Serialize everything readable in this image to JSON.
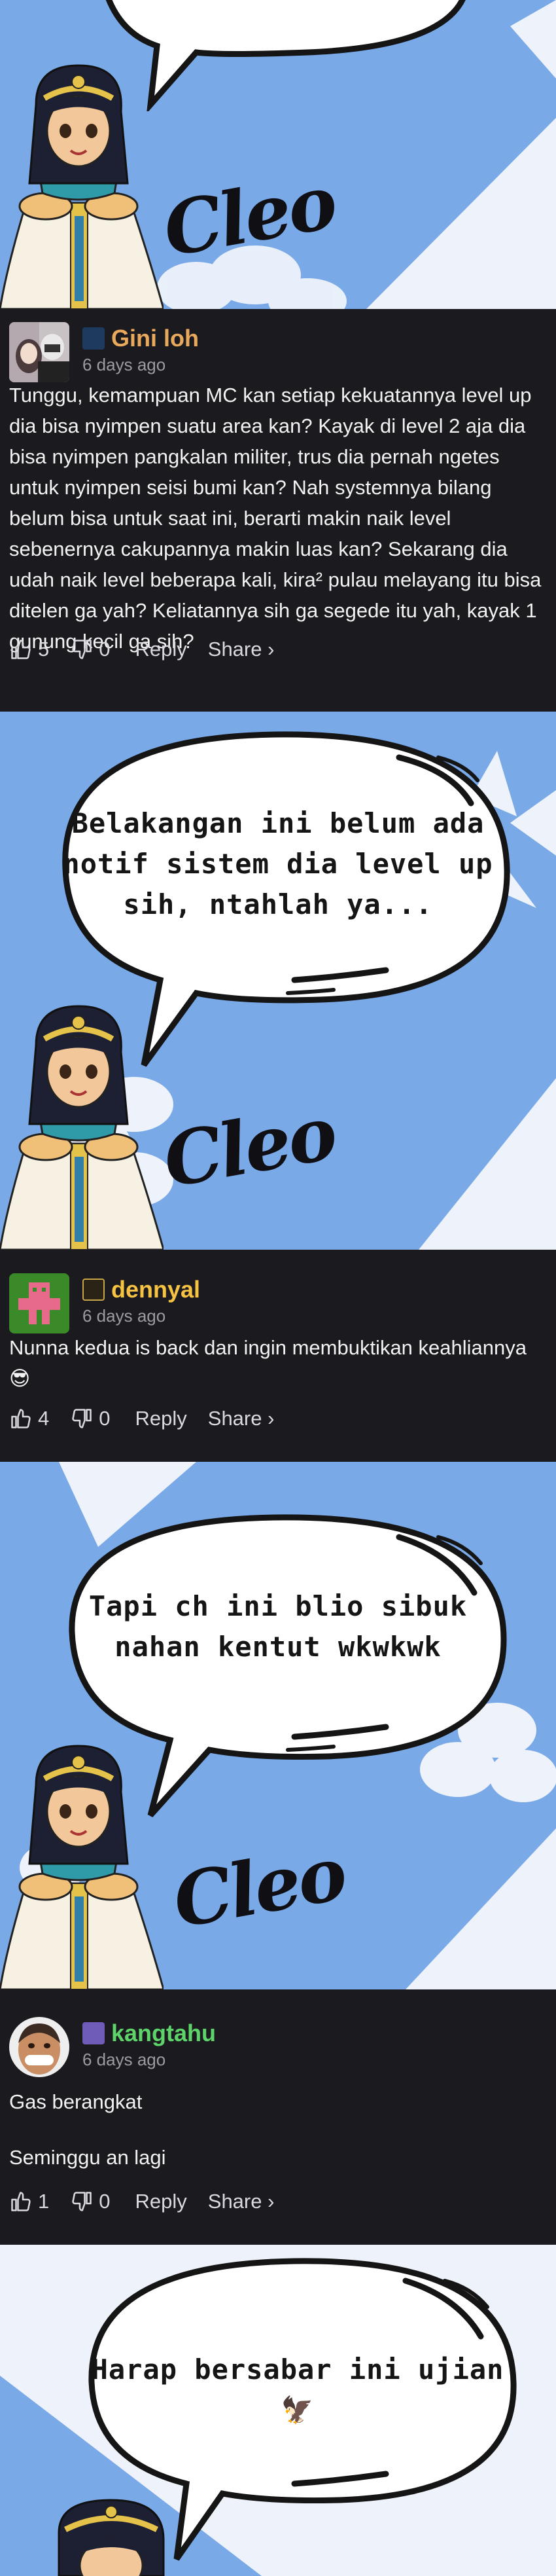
{
  "panel_signature": "Cleo",
  "panels": [
    {
      "bubble_lines": []
    },
    {
      "bubble_lines": [
        "Belakangan ini belum ada",
        "notif sistem dia level up",
        "sih, ntahlah ya..."
      ]
    },
    {
      "bubble_lines": [
        "Tapi ch ini blio sibuk",
        "nahan kentut wkwkwk"
      ]
    },
    {
      "bubble_lines": [
        "Harap bersabar ini ujian",
        "🦅"
      ]
    }
  ],
  "comments": [
    {
      "username": "Gini loh",
      "name_color": "#e8a95c",
      "time": "6 days ago",
      "paragraphs": [
        "Tunggu, kemampuan MC kan setiap kekuatannya level up dia bisa nyimpen suatu area kan? Kayak di level 2 aja dia bisa nyimpen pangkalan militer, trus dia pernah ngetes untuk nyimpen seisi bumi kan? Nah systemnya bilang belum bisa untuk saat ini, berarti makin naik level sebenernya cakupannya makin luas kan? Sekarang dia udah naik level beberapa kali, kira² pulau melayang itu bisa ditelen ga yah? Keliatannya sih ga segede itu yah, kayak 1 gunung kecil ga sih?"
      ],
      "likes": "5",
      "dislikes": "0",
      "reply_label": "Reply",
      "share_label": "Share ›"
    },
    {
      "username": "dennyal",
      "name_color": "#f5c242",
      "time": "6 days ago",
      "paragraphs": [
        "Nunna kedua is back dan ingin membuktikan keahliannya😎"
      ],
      "likes": "4",
      "dislikes": "0",
      "reply_label": "Reply",
      "share_label": "Share ›"
    },
    {
      "username": "kangtahu",
      "name_color": "#5dd36a",
      "time": "6 days ago",
      "paragraphs": [
        "Gas berangkat",
        "Seminggu an lagi"
      ],
      "likes": "1",
      "dislikes": "0",
      "reply_label": "Reply",
      "share_label": "Share ›"
    }
  ],
  "colors": {
    "sky_blue": "#7aa9e8",
    "page_dark": "#1b1b1f",
    "muted_text": "#9b9ba3"
  }
}
